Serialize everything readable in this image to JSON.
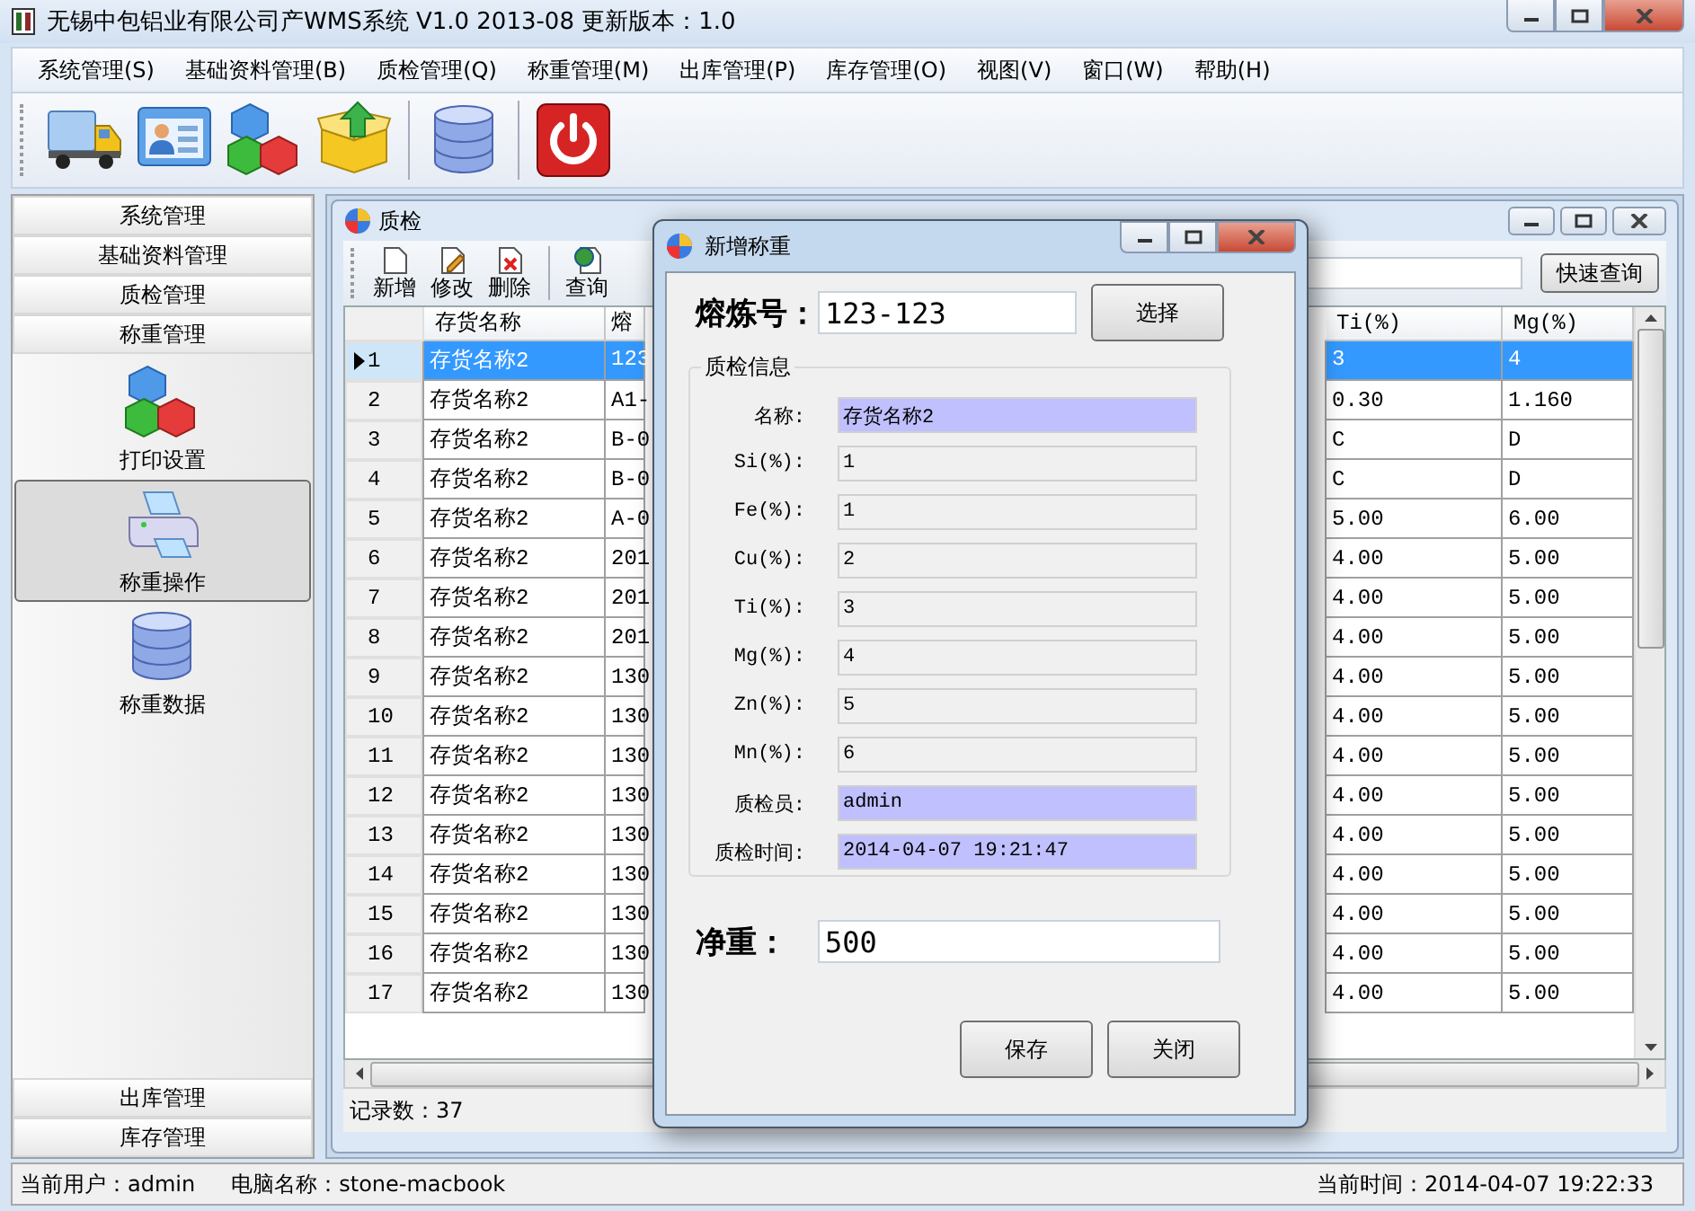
{
  "window": {
    "title": "无锡中包铝业有限公司产WMS系统 V1.0 2013-08 更新版本：1.0"
  },
  "menu": [
    "系统管理(S)",
    "基础资料管理(B)",
    "质检管理(Q)",
    "称重管理(M)",
    "出库管理(P)",
    "库存管理(O)",
    "视图(V)",
    "窗口(W)",
    "帮助(H)"
  ],
  "sidebar": {
    "top_sections": [
      "系统管理",
      "基础资料管理",
      "质检管理",
      "称重管理"
    ],
    "items": [
      {
        "label": "打印设置",
        "selected": false
      },
      {
        "label": "称重操作",
        "selected": true
      },
      {
        "label": "称重数据",
        "selected": false
      }
    ],
    "bottom_sections": [
      "出库管理",
      "库存管理"
    ]
  },
  "child_window": {
    "title": "质检",
    "toolbar": [
      "新增",
      "修改",
      "删除",
      "查询"
    ],
    "quick_search_button": "快速查询",
    "table": {
      "columns": [
        "存货名称",
        "熔",
        "Ti(%)",
        "Mg(%)"
      ],
      "rows": [
        {
          "number": "1",
          "selected": true,
          "cells": [
            "存货名称2",
            "123",
            "3",
            "4"
          ]
        },
        {
          "number": "2",
          "selected": false,
          "cells": [
            "存货名称2",
            "A1-",
            "0.30",
            "1.160"
          ]
        },
        {
          "number": "3",
          "selected": false,
          "cells": [
            "存货名称2",
            "B-0",
            "C",
            "D"
          ]
        },
        {
          "number": "4",
          "selected": false,
          "cells": [
            "存货名称2",
            "B-0",
            "C",
            "D"
          ]
        },
        {
          "number": "5",
          "selected": false,
          "cells": [
            "存货名称2",
            "A-0",
            "5.00",
            "6.00"
          ]
        },
        {
          "number": "6",
          "selected": false,
          "cells": [
            "存货名称2",
            "201",
            "4.00",
            "5.00"
          ]
        },
        {
          "number": "7",
          "selected": false,
          "cells": [
            "存货名称2",
            "201",
            "4.00",
            "5.00"
          ]
        },
        {
          "number": "8",
          "selected": false,
          "cells": [
            "存货名称2",
            "201",
            "4.00",
            "5.00"
          ]
        },
        {
          "number": "9",
          "selected": false,
          "cells": [
            "存货名称2",
            "130",
            "4.00",
            "5.00"
          ]
        },
        {
          "number": "10",
          "selected": false,
          "cells": [
            "存货名称2",
            "130",
            "4.00",
            "5.00"
          ]
        },
        {
          "number": "11",
          "selected": false,
          "cells": [
            "存货名称2",
            "130",
            "4.00",
            "5.00"
          ]
        },
        {
          "number": "12",
          "selected": false,
          "cells": [
            "存货名称2",
            "130",
            "4.00",
            "5.00"
          ]
        },
        {
          "number": "13",
          "selected": false,
          "cells": [
            "存货名称2",
            "130",
            "4.00",
            "5.00"
          ]
        },
        {
          "number": "14",
          "selected": false,
          "cells": [
            "存货名称2",
            "130",
            "4.00",
            "5.00"
          ]
        },
        {
          "number": "15",
          "selected": false,
          "cells": [
            "存货名称2",
            "130",
            "4.00",
            "5.00"
          ]
        },
        {
          "number": "16",
          "selected": false,
          "cells": [
            "存货名称2",
            "130",
            "4.00",
            "5.00"
          ]
        },
        {
          "number": "17",
          "selected": false,
          "cells": [
            "存货名称2",
            "130",
            "4.00",
            "5.00"
          ]
        }
      ]
    },
    "record_count": "记录数：37"
  },
  "dialog": {
    "title": "新增称重",
    "batch": {
      "label": "熔炼号：",
      "value": "123-123"
    },
    "select_button": "选择",
    "group": {
      "title": "质检信息",
      "fields": [
        {
          "label": "名称:",
          "value": "存货名称2",
          "highlighted": true
        },
        {
          "label": "Si(%):",
          "value": "1",
          "highlighted": false
        },
        {
          "label": "Fe(%):",
          "value": "1",
          "highlighted": false
        },
        {
          "label": "Cu(%):",
          "value": "2",
          "highlighted": false
        },
        {
          "label": "Ti(%):",
          "value": "3",
          "highlighted": false
        },
        {
          "label": "Mg(%):",
          "value": "4",
          "highlighted": false
        },
        {
          "label": "Zn(%):",
          "value": "5",
          "highlighted": false
        },
        {
          "label": "Mn(%):",
          "value": "6",
          "highlighted": false
        },
        {
          "label": "质检员:",
          "value": "admin",
          "highlighted": true
        },
        {
          "label": "质检时间:",
          "value": "2014-04-07 19:21:47",
          "highlighted": true
        }
      ]
    },
    "net_weight": {
      "label": "净重：",
      "value": "500"
    },
    "buttons": [
      "保存",
      "关闭"
    ]
  },
  "status_bar": {
    "user": "当前用户：admin",
    "computer": "电脑名称：stone-macbook",
    "time": "当前时间：2014-04-07 19:22:33"
  }
}
